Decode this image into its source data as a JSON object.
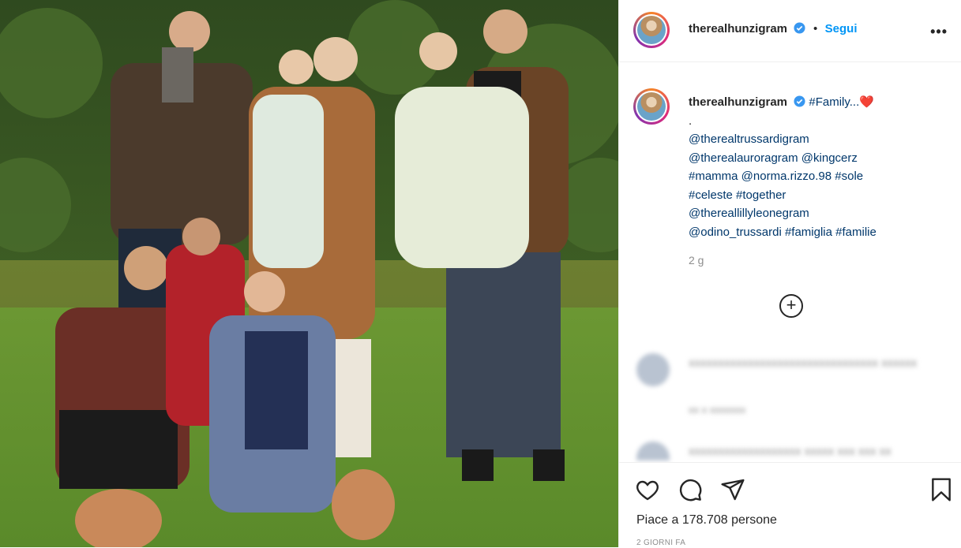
{
  "post": {
    "username": "therealhunzigram",
    "follow_label": "Segui",
    "separator": "•",
    "more_label": "•••",
    "caption": {
      "username": "therealhunzigram",
      "lines": [
        "#Family...❤️",
        ".",
        "@therealtrussardigram",
        "@therealauroragram @kingcerz",
        "#mamma @norma.rizzo.98 #sole",
        "#celeste #together",
        "@thereallillyleonegram",
        "@odino_trussardi #famiglia #familie"
      ],
      "time": "2 g"
    },
    "load_more_label": "+",
    "comments_blurred": [
      {
        "text": "xxxxxxxxxxxxxxxxxxxxxxxxxxxxxxxx xxxxxx",
        "meta": "xx x  xxxxxxx"
      },
      {
        "text": "xxxxxxxxxxxxxxxxxxx xxxxx xxx xxx xx"
      }
    ],
    "likes_text": "Piace a 178.708 persone",
    "time_ago": "2 GIORNI FA"
  },
  "icons": {
    "like": "heart-icon",
    "comment": "comment-icon",
    "share": "paper-plane-icon",
    "save": "bookmark-icon",
    "verified": "verified-badge-icon"
  },
  "colors": {
    "link": "#00376b",
    "follow": "#0095f6",
    "verified": "#3897f0",
    "muted": "#8e8e8e",
    "heart": "#ed4956"
  }
}
